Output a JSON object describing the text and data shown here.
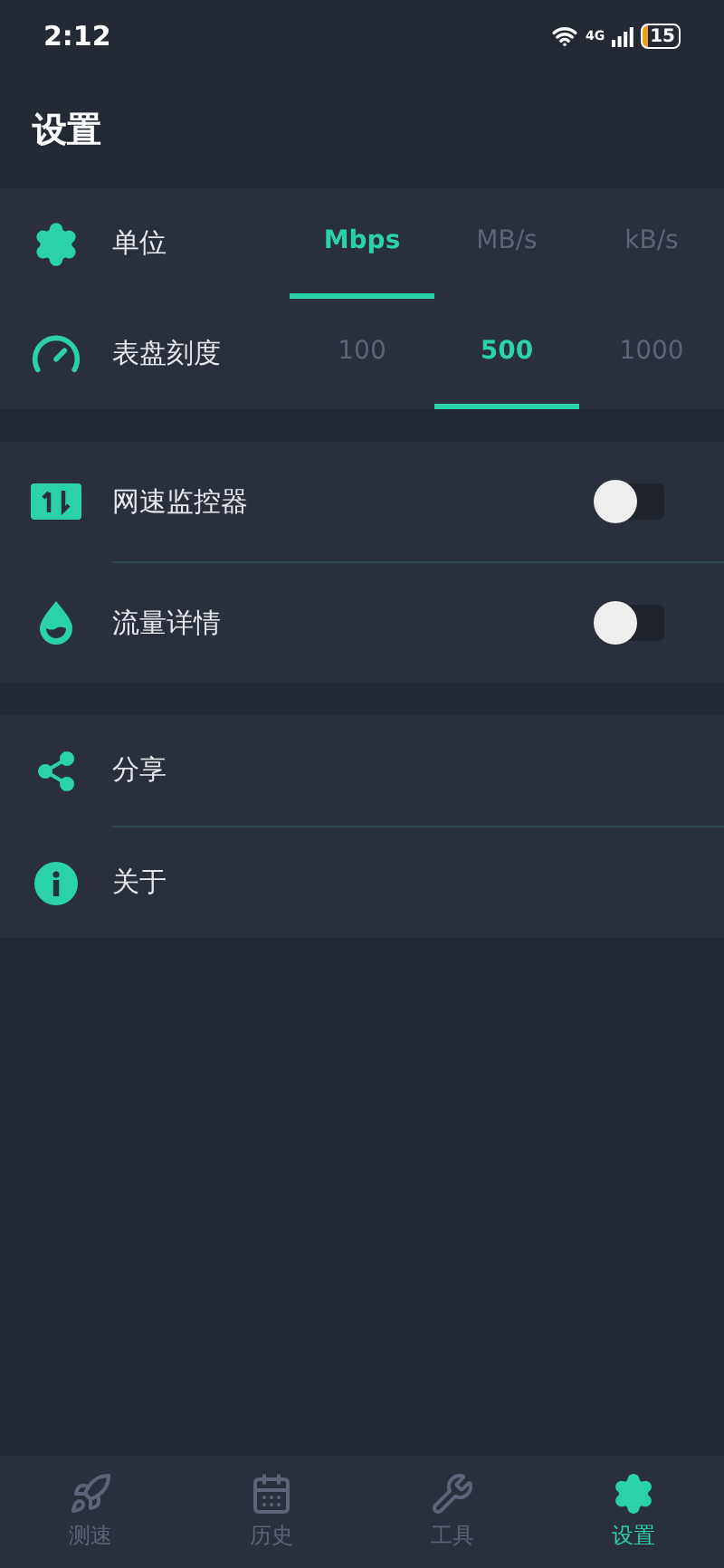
{
  "status_bar": {
    "time": "2:12",
    "network": "4G",
    "battery": "15"
  },
  "header": {
    "title": "设置"
  },
  "sections": [
    {
      "rows": [
        {
          "kind": "segmented",
          "label": "单位",
          "options": [
            {
              "label": "Mbps",
              "selected": true
            },
            {
              "label": "MB/s",
              "selected": false
            },
            {
              "label": "kB/s",
              "selected": false
            }
          ]
        },
        {
          "kind": "segmented",
          "label": "表盘刻度",
          "options": [
            {
              "label": "100",
              "selected": false
            },
            {
              "label": "500",
              "selected": true
            },
            {
              "label": "1000",
              "selected": false
            }
          ]
        }
      ]
    },
    {
      "rows": [
        {
          "kind": "toggle",
          "label": "网速监控器",
          "on": false
        },
        {
          "kind": "toggle",
          "label": "流量详情",
          "on": false
        }
      ]
    },
    {
      "rows": [
        {
          "kind": "link",
          "label": "分享"
        },
        {
          "kind": "link",
          "label": "关于"
        }
      ]
    }
  ],
  "bottom_nav": [
    {
      "label": "测速",
      "selected": false
    },
    {
      "label": "历史",
      "selected": false
    },
    {
      "label": "工具",
      "selected": false
    },
    {
      "label": "设置",
      "selected": true
    }
  ]
}
